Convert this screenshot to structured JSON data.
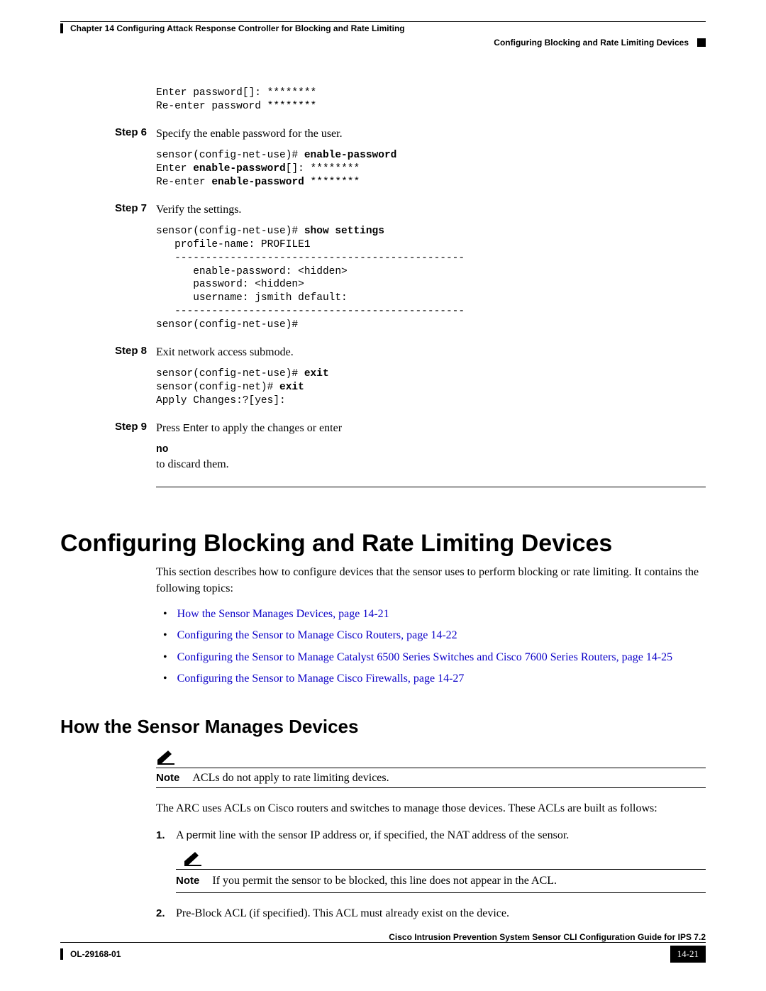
{
  "header": {
    "chapter": "Chapter 14      Configuring Attack Response Controller for Blocking and Rate Limiting",
    "section": "Configuring Blocking and Rate Limiting Devices"
  },
  "code_intro": "Enter password[]: ********\nRe-enter password ********",
  "steps": [
    {
      "label": "Step 6",
      "text": "Specify the enable password for the user.",
      "code": "sensor(config-net-use)# enable-password\nEnter enable-password[]: ********\nRe-enter enable-password ********",
      "code_bold_parts": [
        "enable-password"
      ]
    },
    {
      "label": "Step 7",
      "text": "Verify the settings.",
      "code": "sensor(config-net-use)# show settings\n   profile-name: PROFILE1\n   -----------------------------------------------\n      enable-password: <hidden>\n      password: <hidden>\n      username: jsmith default:\n   -----------------------------------------------\nsensor(config-net-use)#",
      "code_bold_parts": [
        "show settings"
      ]
    },
    {
      "label": "Step 8",
      "text": "Exit network access submode.",
      "code": "sensor(config-net-use)# exit\nsensor(config-net)# exit\nApply Changes:?[yes]:",
      "code_bold_parts": [
        "exit"
      ]
    },
    {
      "label": "Step 9",
      "text_html": "Press <span class='sf'>Enter</span> to apply the changes or enter <span class='code code-bold'>no</span> to discard them."
    }
  ],
  "section_title": "Configuring Blocking and Rate Limiting Devices",
  "section_intro": "This section describes how to configure devices that the sensor uses to perform blocking or rate limiting. It contains the following topics:",
  "links": [
    "How the Sensor Manages Devices, page 14-21",
    "Configuring the Sensor to Manage Cisco Routers, page 14-22",
    "Configuring the Sensor to Manage Catalyst 6500 Series Switches and Cisco 7600 Series Routers, page 14-25",
    "Configuring the Sensor to Manage Cisco Firewalls, page 14-27"
  ],
  "subsection_title": "How the Sensor Manages Devices",
  "top_note": "ACLs do not apply to rate limiting devices.",
  "subsection_para": "The ARC uses ACLs on Cisco routers and switches to manage those devices. These ACLs are built as follows:",
  "numlist": [
    {
      "num": "1.",
      "text_html": "A <span class='sf'>permit</span> line with the sensor IP address or, if specified, the NAT address of the sensor.",
      "note": "If you permit the sensor to be blocked, this line does not appear in the ACL."
    },
    {
      "num": "2.",
      "text": "Pre-Block ACL (if specified). This ACL must already exist on the device."
    }
  ],
  "footer": {
    "guide": "Cisco Intrusion Prevention System Sensor CLI Configuration Guide for IPS 7.2",
    "doc": "OL-29168-01",
    "page": "14-21"
  }
}
